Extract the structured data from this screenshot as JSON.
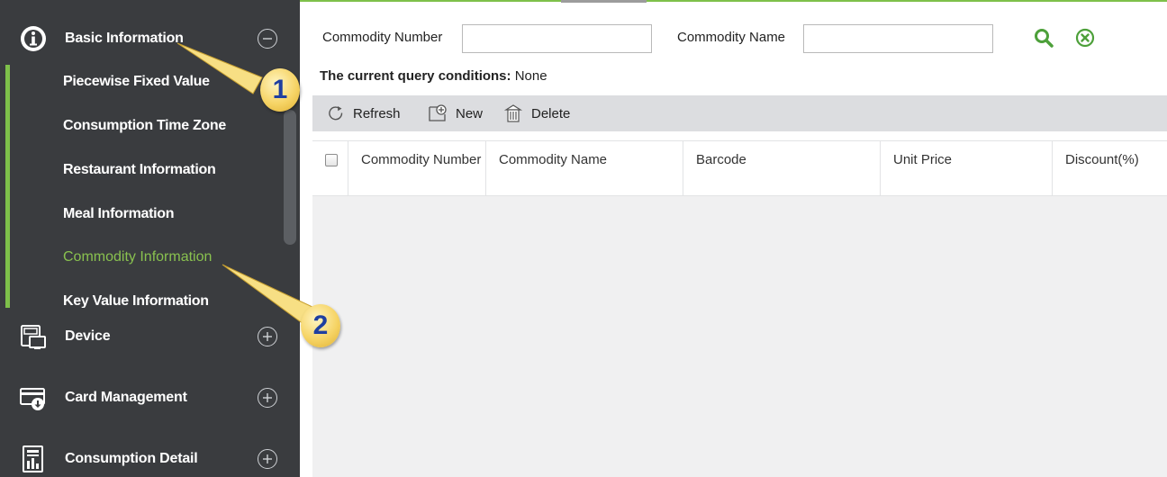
{
  "sidebar": {
    "basic": {
      "label": "Basic Information",
      "icon": "info-icon",
      "toggle": "⊖"
    },
    "sub_items": [
      {
        "label": "Piecewise Fixed Value"
      },
      {
        "label": "Consumption Time Zone"
      },
      {
        "label": "Restaurant Information"
      },
      {
        "label": "Meal Information"
      },
      {
        "label": "Commodity Information",
        "active": true
      },
      {
        "label": "Key Value Information"
      }
    ],
    "device": {
      "label": "Device",
      "icon": "device-icon",
      "toggle": "⊕"
    },
    "card": {
      "label": "Card Management",
      "icon": "card-icon",
      "toggle": "⊕"
    },
    "detail": {
      "label": "Consumption Detail",
      "icon": "report-icon",
      "toggle": "⊕"
    }
  },
  "callouts": [
    "1",
    "2"
  ],
  "query": {
    "number_label": "Commodity Number",
    "number_value": "",
    "name_label": "Commodity Name",
    "name_value": "",
    "conditions_label": "The current query conditions:",
    "conditions_value": "None"
  },
  "toolbar": {
    "refresh": "Refresh",
    "new": "New",
    "delete": "Delete"
  },
  "table": {
    "columns": [
      "Commodity Number",
      "Commodity Name",
      "Barcode",
      "Unit Price",
      "Discount(%)"
    ],
    "rows": []
  },
  "colors": {
    "sidebar_bg": "#3a3c3f",
    "accent_green": "#7ec04a",
    "active_text": "#89c14f",
    "toolbar_bg": "#dcdde0",
    "grid_body_bg": "#f0f0f1"
  }
}
